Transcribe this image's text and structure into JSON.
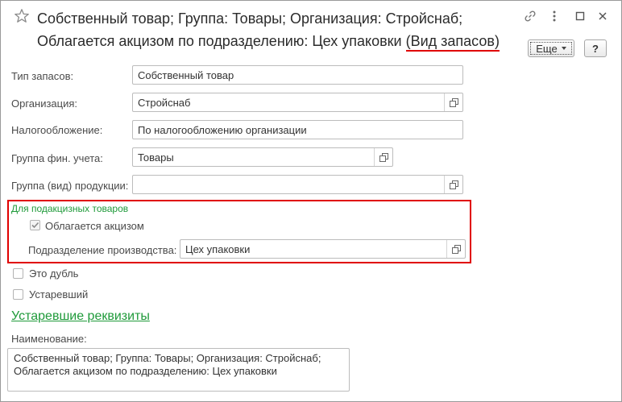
{
  "window": {
    "title_line1": "Собственный товар; Группа: Товары; Организация: Стройснаб;",
    "title_line2_prefix": "Облагается акцизом по подразделению: Цех упаковки ",
    "title_line2_highlight": "(Вид запасов)"
  },
  "toolbar": {
    "more_label": "Еще",
    "help_label": "?"
  },
  "form": {
    "stock_type": {
      "label": "Тип запасов:",
      "value": "Собственный товар"
    },
    "organization": {
      "label": "Организация:",
      "value": "Стройснаб"
    },
    "taxation": {
      "label": "Налогообложение:",
      "value": "По налогообложению организации"
    },
    "fin_group": {
      "label": "Группа фин. учета:",
      "value": "Товары"
    },
    "product_group": {
      "label": "Группа (вид) продукции:",
      "value": ""
    }
  },
  "excise": {
    "group_title": "Для подакцизных товаров",
    "excise_checkbox": {
      "label": "Облагается акцизом",
      "checked": true
    },
    "division": {
      "label": "Подразделение производства:",
      "value": "Цех упаковки"
    }
  },
  "flags": {
    "duplicate": {
      "label": "Это дубль",
      "checked": false
    },
    "obsolete": {
      "label": "Устаревший",
      "checked": false
    }
  },
  "obsolete_link": "Устаревшие реквизиты",
  "name_field": {
    "label": "Наименование:",
    "value": "Собственный товар; Группа: Товары; Организация: Стройснаб;\nОблагается акцизом по подразделению: Цех упаковки"
  },
  "colors": {
    "accent_green": "#1f9a3a",
    "highlight_red": "#e00000"
  },
  "icons": {
    "favorite": "star-icon",
    "link": "link-icon",
    "more_actions": "more-vert-icon",
    "maximize": "maximize-icon",
    "close": "close-icon",
    "open": "open-form-icon"
  }
}
